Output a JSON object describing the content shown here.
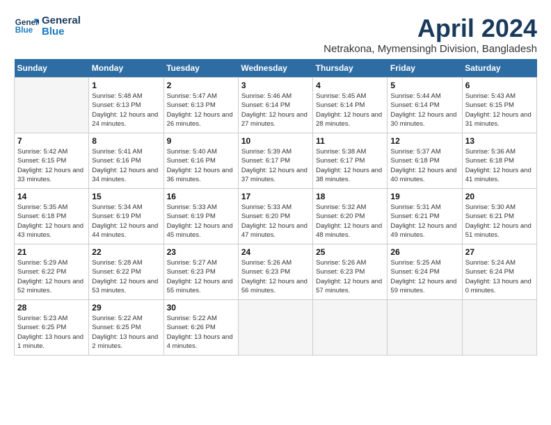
{
  "header": {
    "logo_line1": "General",
    "logo_line2": "Blue",
    "month_title": "April 2024",
    "subtitle": "Netrakona, Mymensingh Division, Bangladesh"
  },
  "weekdays": [
    "Sunday",
    "Monday",
    "Tuesday",
    "Wednesday",
    "Thursday",
    "Friday",
    "Saturday"
  ],
  "weeks": [
    [
      {
        "day": "",
        "sunrise": "",
        "sunset": "",
        "daylight": "",
        "empty": true
      },
      {
        "day": "1",
        "sunrise": "Sunrise: 5:48 AM",
        "sunset": "Sunset: 6:13 PM",
        "daylight": "Daylight: 12 hours and 24 minutes.",
        "empty": false
      },
      {
        "day": "2",
        "sunrise": "Sunrise: 5:47 AM",
        "sunset": "Sunset: 6:13 PM",
        "daylight": "Daylight: 12 hours and 26 minutes.",
        "empty": false
      },
      {
        "day": "3",
        "sunrise": "Sunrise: 5:46 AM",
        "sunset": "Sunset: 6:14 PM",
        "daylight": "Daylight: 12 hours and 27 minutes.",
        "empty": false
      },
      {
        "day": "4",
        "sunrise": "Sunrise: 5:45 AM",
        "sunset": "Sunset: 6:14 PM",
        "daylight": "Daylight: 12 hours and 28 minutes.",
        "empty": false
      },
      {
        "day": "5",
        "sunrise": "Sunrise: 5:44 AM",
        "sunset": "Sunset: 6:14 PM",
        "daylight": "Daylight: 12 hours and 30 minutes.",
        "empty": false
      },
      {
        "day": "6",
        "sunrise": "Sunrise: 5:43 AM",
        "sunset": "Sunset: 6:15 PM",
        "daylight": "Daylight: 12 hours and 31 minutes.",
        "empty": false
      }
    ],
    [
      {
        "day": "7",
        "sunrise": "Sunrise: 5:42 AM",
        "sunset": "Sunset: 6:15 PM",
        "daylight": "Daylight: 12 hours and 33 minutes.",
        "empty": false
      },
      {
        "day": "8",
        "sunrise": "Sunrise: 5:41 AM",
        "sunset": "Sunset: 6:16 PM",
        "daylight": "Daylight: 12 hours and 34 minutes.",
        "empty": false
      },
      {
        "day": "9",
        "sunrise": "Sunrise: 5:40 AM",
        "sunset": "Sunset: 6:16 PM",
        "daylight": "Daylight: 12 hours and 36 minutes.",
        "empty": false
      },
      {
        "day": "10",
        "sunrise": "Sunrise: 5:39 AM",
        "sunset": "Sunset: 6:17 PM",
        "daylight": "Daylight: 12 hours and 37 minutes.",
        "empty": false
      },
      {
        "day": "11",
        "sunrise": "Sunrise: 5:38 AM",
        "sunset": "Sunset: 6:17 PM",
        "daylight": "Daylight: 12 hours and 38 minutes.",
        "empty": false
      },
      {
        "day": "12",
        "sunrise": "Sunrise: 5:37 AM",
        "sunset": "Sunset: 6:18 PM",
        "daylight": "Daylight: 12 hours and 40 minutes.",
        "empty": false
      },
      {
        "day": "13",
        "sunrise": "Sunrise: 5:36 AM",
        "sunset": "Sunset: 6:18 PM",
        "daylight": "Daylight: 12 hours and 41 minutes.",
        "empty": false
      }
    ],
    [
      {
        "day": "14",
        "sunrise": "Sunrise: 5:35 AM",
        "sunset": "Sunset: 6:18 PM",
        "daylight": "Daylight: 12 hours and 43 minutes.",
        "empty": false
      },
      {
        "day": "15",
        "sunrise": "Sunrise: 5:34 AM",
        "sunset": "Sunset: 6:19 PM",
        "daylight": "Daylight: 12 hours and 44 minutes.",
        "empty": false
      },
      {
        "day": "16",
        "sunrise": "Sunrise: 5:33 AM",
        "sunset": "Sunset: 6:19 PM",
        "daylight": "Daylight: 12 hours and 45 minutes.",
        "empty": false
      },
      {
        "day": "17",
        "sunrise": "Sunrise: 5:33 AM",
        "sunset": "Sunset: 6:20 PM",
        "daylight": "Daylight: 12 hours and 47 minutes.",
        "empty": false
      },
      {
        "day": "18",
        "sunrise": "Sunrise: 5:32 AM",
        "sunset": "Sunset: 6:20 PM",
        "daylight": "Daylight: 12 hours and 48 minutes.",
        "empty": false
      },
      {
        "day": "19",
        "sunrise": "Sunrise: 5:31 AM",
        "sunset": "Sunset: 6:21 PM",
        "daylight": "Daylight: 12 hours and 49 minutes.",
        "empty": false
      },
      {
        "day": "20",
        "sunrise": "Sunrise: 5:30 AM",
        "sunset": "Sunset: 6:21 PM",
        "daylight": "Daylight: 12 hours and 51 minutes.",
        "empty": false
      }
    ],
    [
      {
        "day": "21",
        "sunrise": "Sunrise: 5:29 AM",
        "sunset": "Sunset: 6:22 PM",
        "daylight": "Daylight: 12 hours and 52 minutes.",
        "empty": false
      },
      {
        "day": "22",
        "sunrise": "Sunrise: 5:28 AM",
        "sunset": "Sunset: 6:22 PM",
        "daylight": "Daylight: 12 hours and 53 minutes.",
        "empty": false
      },
      {
        "day": "23",
        "sunrise": "Sunrise: 5:27 AM",
        "sunset": "Sunset: 6:23 PM",
        "daylight": "Daylight: 12 hours and 55 minutes.",
        "empty": false
      },
      {
        "day": "24",
        "sunrise": "Sunrise: 5:26 AM",
        "sunset": "Sunset: 6:23 PM",
        "daylight": "Daylight: 12 hours and 56 minutes.",
        "empty": false
      },
      {
        "day": "25",
        "sunrise": "Sunrise: 5:26 AM",
        "sunset": "Sunset: 6:23 PM",
        "daylight": "Daylight: 12 hours and 57 minutes.",
        "empty": false
      },
      {
        "day": "26",
        "sunrise": "Sunrise: 5:25 AM",
        "sunset": "Sunset: 6:24 PM",
        "daylight": "Daylight: 12 hours and 59 minutes.",
        "empty": false
      },
      {
        "day": "27",
        "sunrise": "Sunrise: 5:24 AM",
        "sunset": "Sunset: 6:24 PM",
        "daylight": "Daylight: 13 hours and 0 minutes.",
        "empty": false
      }
    ],
    [
      {
        "day": "28",
        "sunrise": "Sunrise: 5:23 AM",
        "sunset": "Sunset: 6:25 PM",
        "daylight": "Daylight: 13 hours and 1 minute.",
        "empty": false
      },
      {
        "day": "29",
        "sunrise": "Sunrise: 5:22 AM",
        "sunset": "Sunset: 6:25 PM",
        "daylight": "Daylight: 13 hours and 2 minutes.",
        "empty": false
      },
      {
        "day": "30",
        "sunrise": "Sunrise: 5:22 AM",
        "sunset": "Sunset: 6:26 PM",
        "daylight": "Daylight: 13 hours and 4 minutes.",
        "empty": false
      },
      {
        "day": "",
        "sunrise": "",
        "sunset": "",
        "daylight": "",
        "empty": true
      },
      {
        "day": "",
        "sunrise": "",
        "sunset": "",
        "daylight": "",
        "empty": true
      },
      {
        "day": "",
        "sunrise": "",
        "sunset": "",
        "daylight": "",
        "empty": true
      },
      {
        "day": "",
        "sunrise": "",
        "sunset": "",
        "daylight": "",
        "empty": true
      }
    ]
  ]
}
